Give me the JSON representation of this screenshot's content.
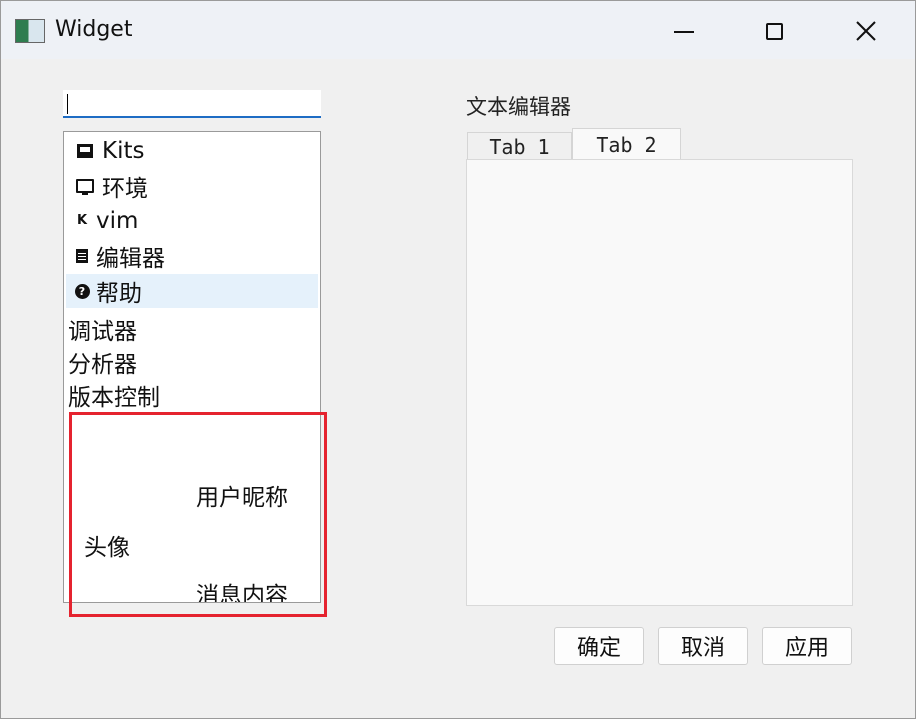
{
  "window": {
    "title": "Widget",
    "icon": "app-window-icon"
  },
  "search": {
    "value": ""
  },
  "tree": {
    "items": [
      {
        "label": "Kits",
        "icon": "kits-icon"
      },
      {
        "label": "环境",
        "icon": "monitor-icon"
      },
      {
        "label": "vim",
        "icon": "vim-fake-icon"
      },
      {
        "label": "编辑器",
        "icon": "editor-icon"
      },
      {
        "label": "帮助",
        "icon": "help-icon",
        "selected": true
      }
    ],
    "plain_items": [
      "调试器",
      "分析器",
      "版本控制"
    ],
    "message_widget": {
      "nickname": "用户昵称",
      "avatar": "头像",
      "message": "消息内容"
    }
  },
  "editor": {
    "title": "文本编辑器",
    "tabs": [
      "Tab 1",
      "Tab 2"
    ],
    "active_tab": "Tab 2"
  },
  "buttons": {
    "ok": "确定",
    "cancel": "取消",
    "apply": "应用"
  },
  "colors": {
    "highlight_border": "#e5232f",
    "selection": "#e5f1fb",
    "focus_underline": "#1e6cc4"
  }
}
